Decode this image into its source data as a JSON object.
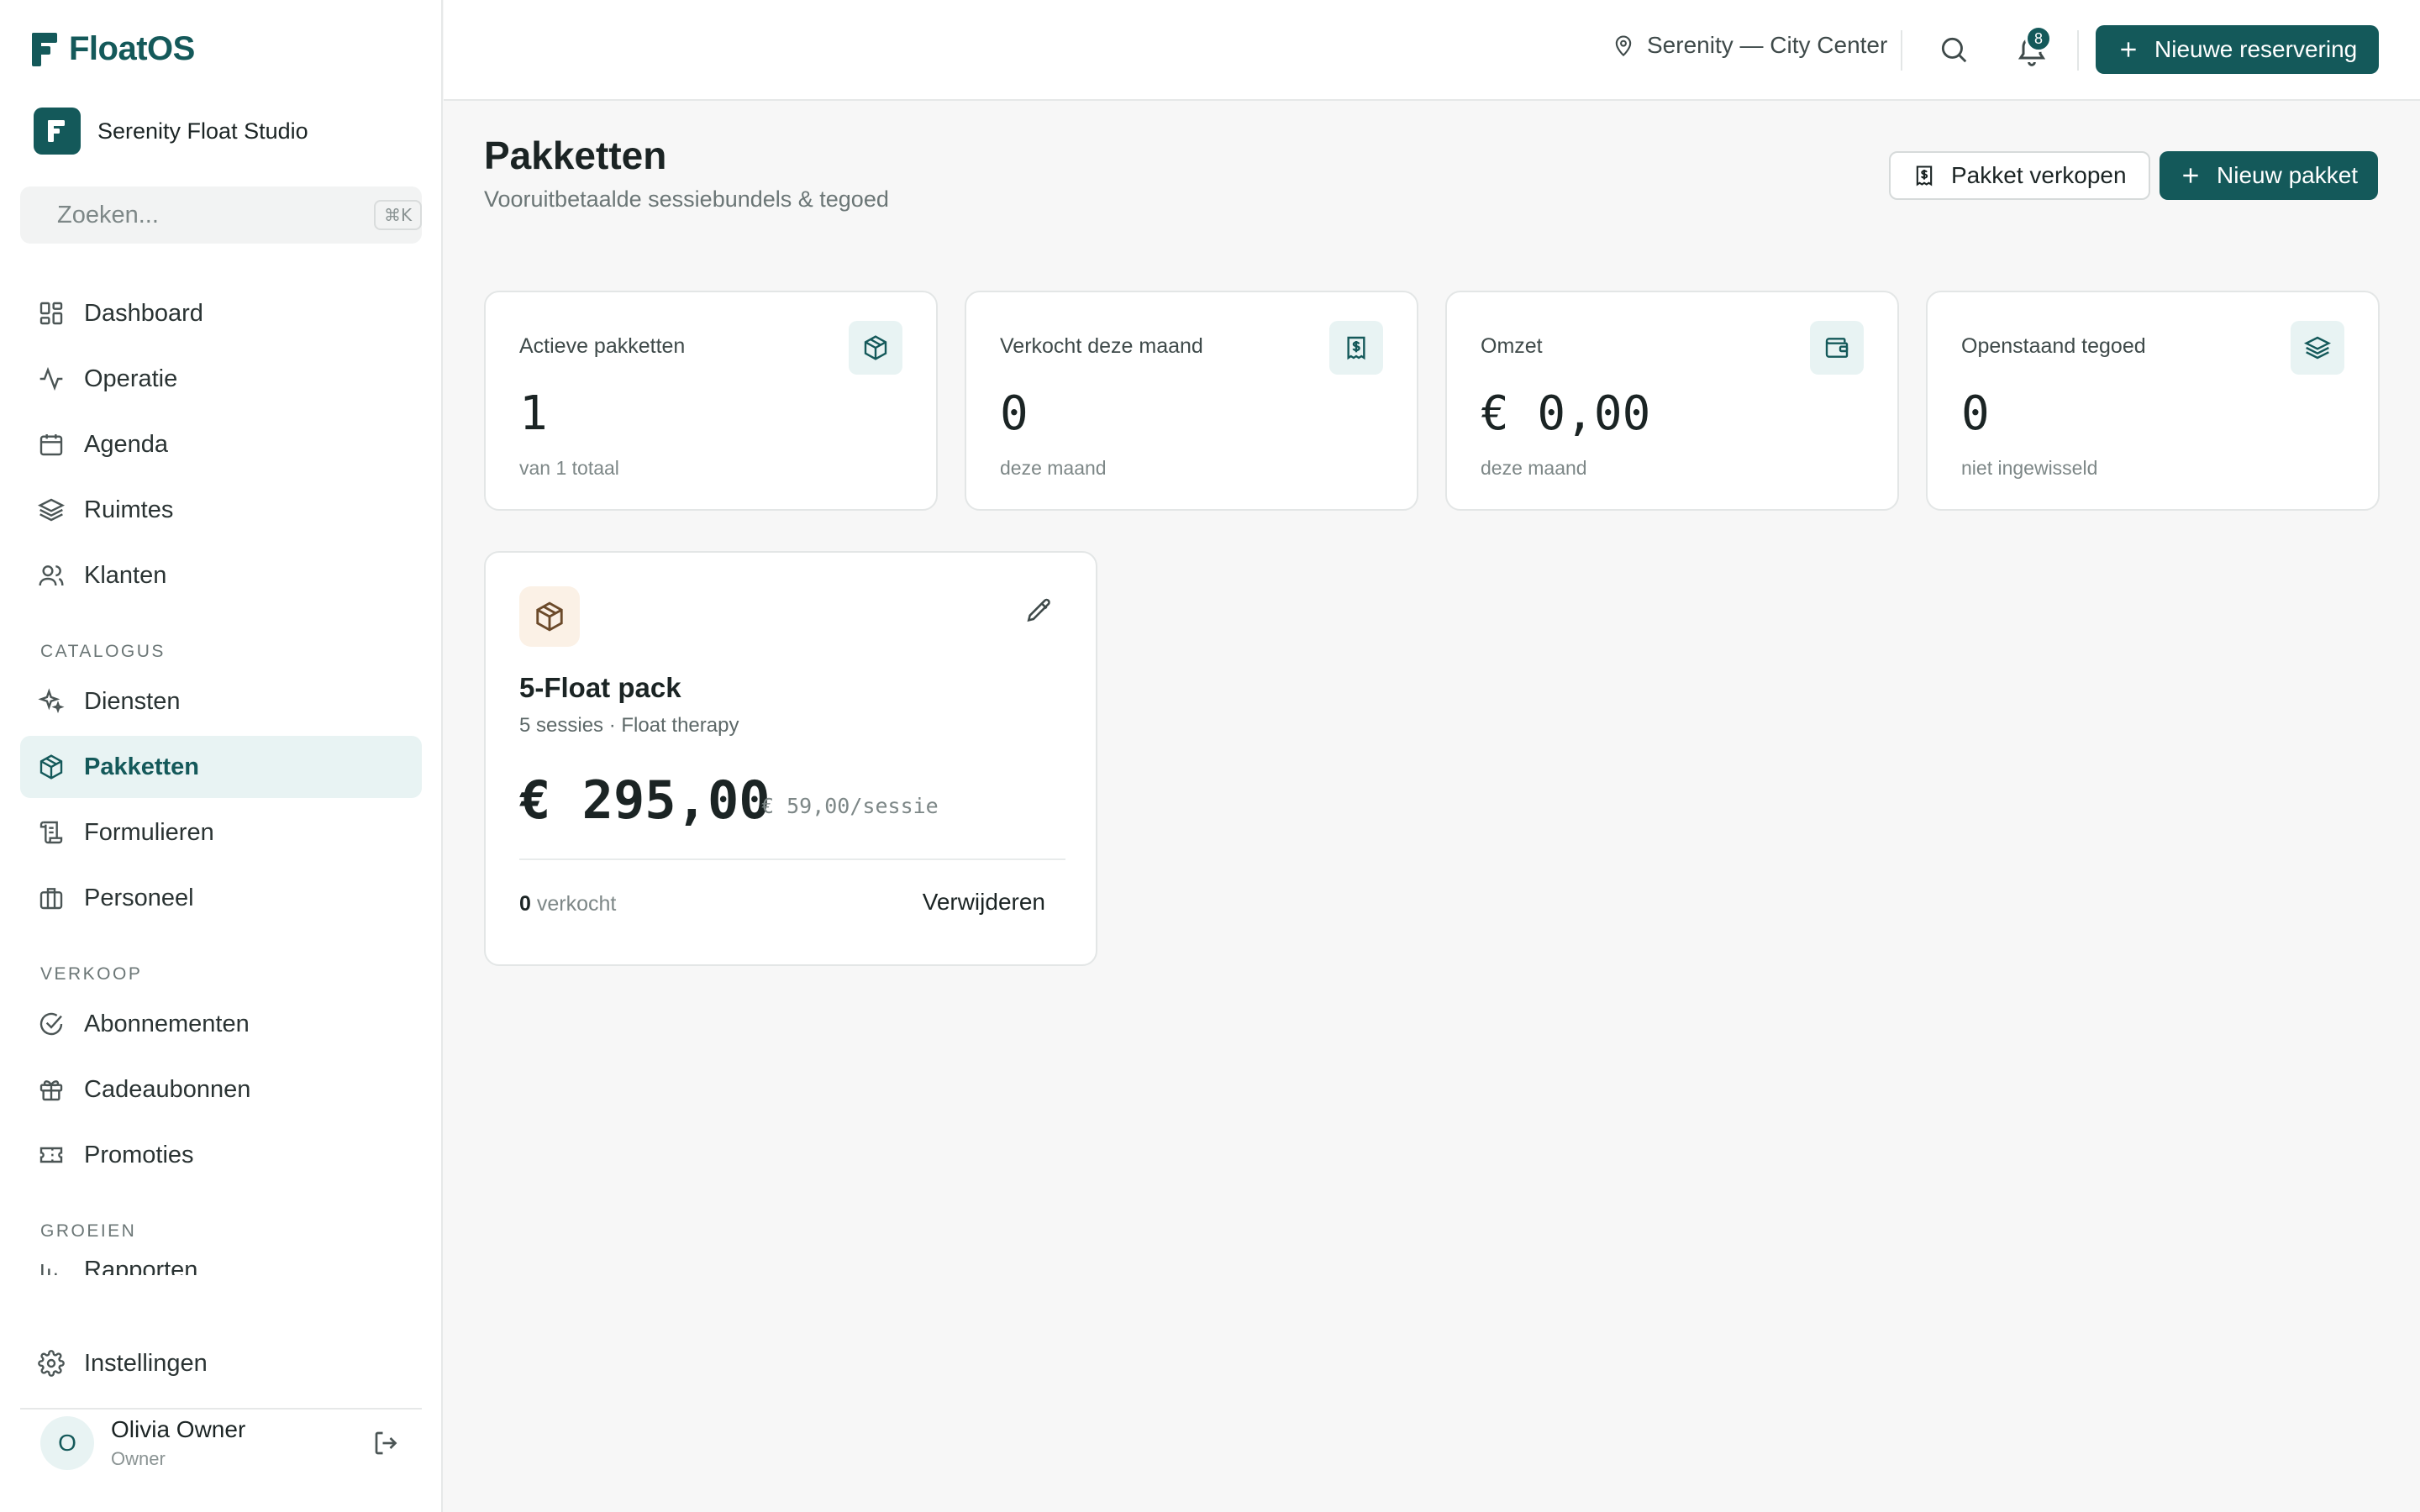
{
  "brand": {
    "name": "FloatOS"
  },
  "studio": {
    "name": "Serenity Float Studio"
  },
  "search": {
    "placeholder": "Zoeken...",
    "shortcut": "⌘K"
  },
  "nav": {
    "main": [
      {
        "label": "Dashboard",
        "icon": "dashboard-grid-icon"
      },
      {
        "label": "Operatie",
        "icon": "activity-pulse-icon"
      },
      {
        "label": "Agenda",
        "icon": "calendar-icon"
      },
      {
        "label": "Ruimtes",
        "icon": "layers-icon"
      },
      {
        "label": "Klanten",
        "icon": "users-icon"
      }
    ],
    "catalogus_label": "CATALOGUS",
    "catalogus": [
      {
        "label": "Diensten",
        "icon": "sparkles-icon"
      },
      {
        "label": "Pakketten",
        "icon": "package-icon",
        "active": true
      },
      {
        "label": "Formulieren",
        "icon": "scroll-icon"
      },
      {
        "label": "Personeel",
        "icon": "briefcase-icon"
      }
    ],
    "verkoop_label": "VERKOOP",
    "verkoop": [
      {
        "label": "Abonnementen",
        "icon": "check-circle-icon"
      },
      {
        "label": "Cadeaubonnen",
        "icon": "gift-icon"
      },
      {
        "label": "Promoties",
        "icon": "ticket-icon"
      }
    ],
    "groeien_label": "GROEIEN",
    "groeien": [
      {
        "label": "Rapporten",
        "icon": "bar-chart-icon"
      }
    ],
    "settings_label": "Instellingen"
  },
  "user": {
    "initial": "O",
    "name": "Olivia Owner",
    "role": "Owner"
  },
  "topbar": {
    "location": "Serenity — City Center",
    "notifications": "8",
    "new_reservation": "Nieuwe reservering"
  },
  "page": {
    "title": "Pakketten",
    "subtitle": "Vooruitbetaalde sessiebundels & tegoed",
    "sell_button": "Pakket verkopen",
    "new_button": "Nieuw pakket"
  },
  "stats": [
    {
      "label": "Actieve pakketten",
      "value": "1",
      "note": "van 1 totaal",
      "icon": "package-icon"
    },
    {
      "label": "Verkocht deze maand",
      "value": "0",
      "note": "deze maand",
      "icon": "receipt-icon"
    },
    {
      "label": "Omzet",
      "value": "€ 0,00",
      "note": "deze maand",
      "icon": "wallet-icon"
    },
    {
      "label": "Openstaand tegoed",
      "value": "0",
      "note": "niet ingewisseld",
      "icon": "layers-icon"
    }
  ],
  "package": {
    "name": "5-Float pack",
    "meta": "5 sessies · Float therapy",
    "price": "€ 295,00",
    "per_session": "€ 59,00/sessie",
    "sold_count": "0",
    "sold_label": "verkocht",
    "delete_label": "Verwijderen"
  },
  "colors": {
    "accent": "#14595a",
    "accent_light": "#e8f3f3",
    "package_icon_bg": "#fbf1e6"
  }
}
